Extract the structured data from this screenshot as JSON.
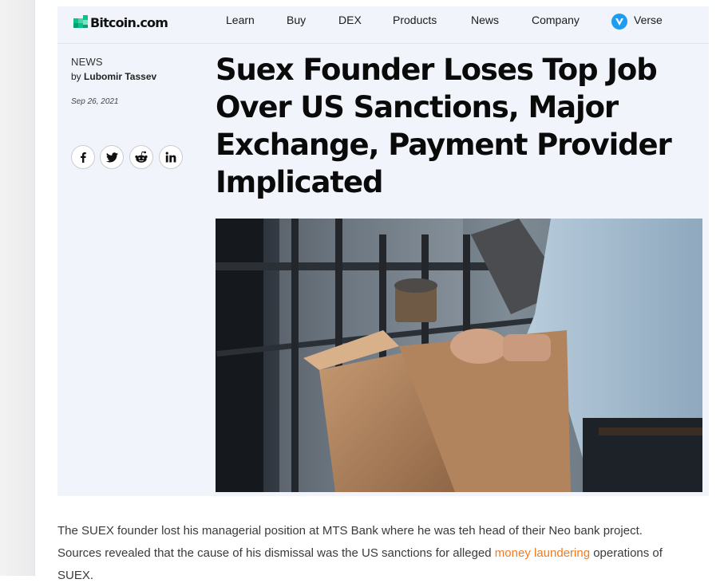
{
  "header": {
    "logo_text": "Bitcoin.com",
    "nav": [
      "Learn",
      "Buy",
      "DEX",
      "Products",
      "News",
      "Company",
      "Verse"
    ]
  },
  "article": {
    "category": "NEWS",
    "by_prefix": "by",
    "author": "Lubomir Tassev",
    "date": "Sep 26, 2021",
    "title": "Suex Founder Loses Top Job Over US Sanctions, Major Exchange, Payment Provider Implicated",
    "share_icons": [
      "facebook-icon",
      "twitter-icon",
      "reddit-icon",
      "linkedin-icon"
    ],
    "paragraph": {
      "before_link": "The SUEX founder lost his managerial position at MTS Bank where he was teh head of their Neo bank project. Sources revealed that the cause of his dismissal was the US sanctions for alleged ",
      "link_text": "money laundering",
      "after_link": " operations of SUEX."
    }
  },
  "colors": {
    "brand_green": "#0ac18e",
    "link_orange": "#f07b22",
    "verse_blue": "#1f9cf0",
    "page_bg": "#f1f5fb"
  }
}
